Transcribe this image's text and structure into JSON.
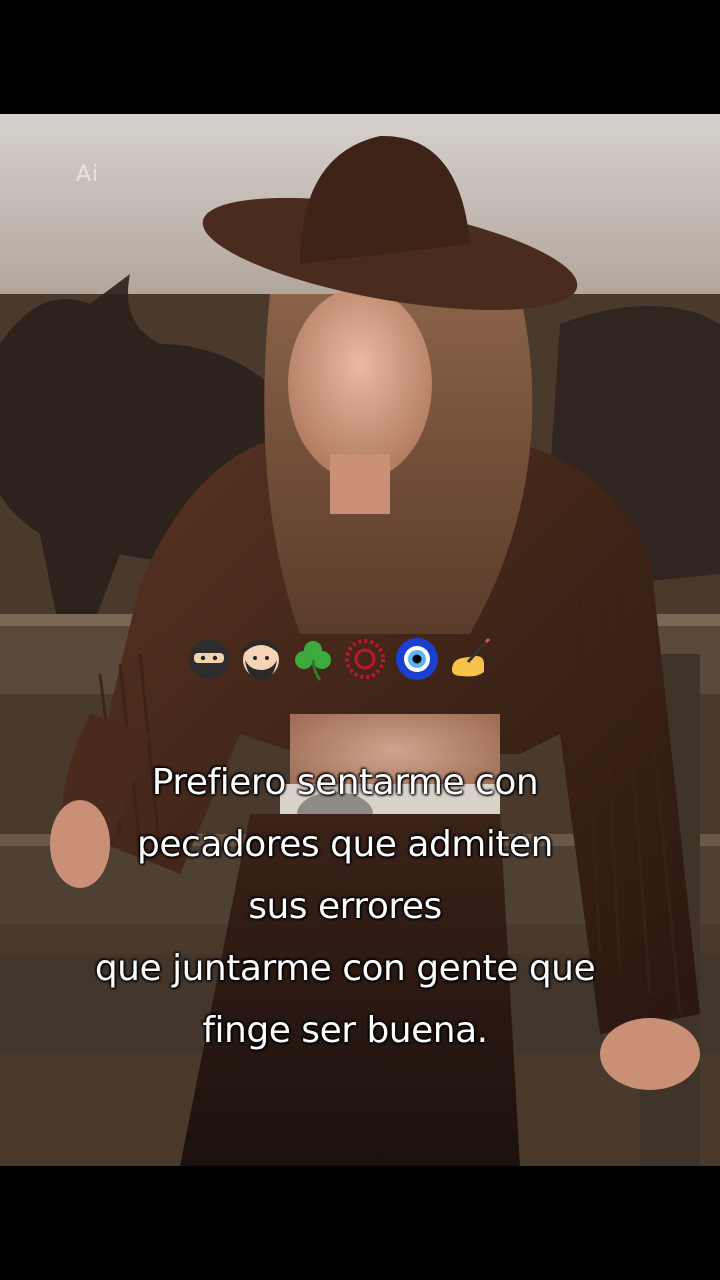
{
  "watermark": "Ai",
  "emojis": [
    {
      "icon": "ninja-icon"
    },
    {
      "icon": "bearded-man-icon"
    },
    {
      "icon": "shamrock-icon"
    },
    {
      "icon": "red-circle-icon"
    },
    {
      "icon": "nazar-amulet-icon"
    },
    {
      "icon": "writing-hand-icon"
    }
  ],
  "caption": {
    "lines": [
      "Prefiero sentarme con",
      "pecadores que admiten",
      "sus errores",
      "que juntarme con gente que",
      "finge ser buena."
    ]
  }
}
